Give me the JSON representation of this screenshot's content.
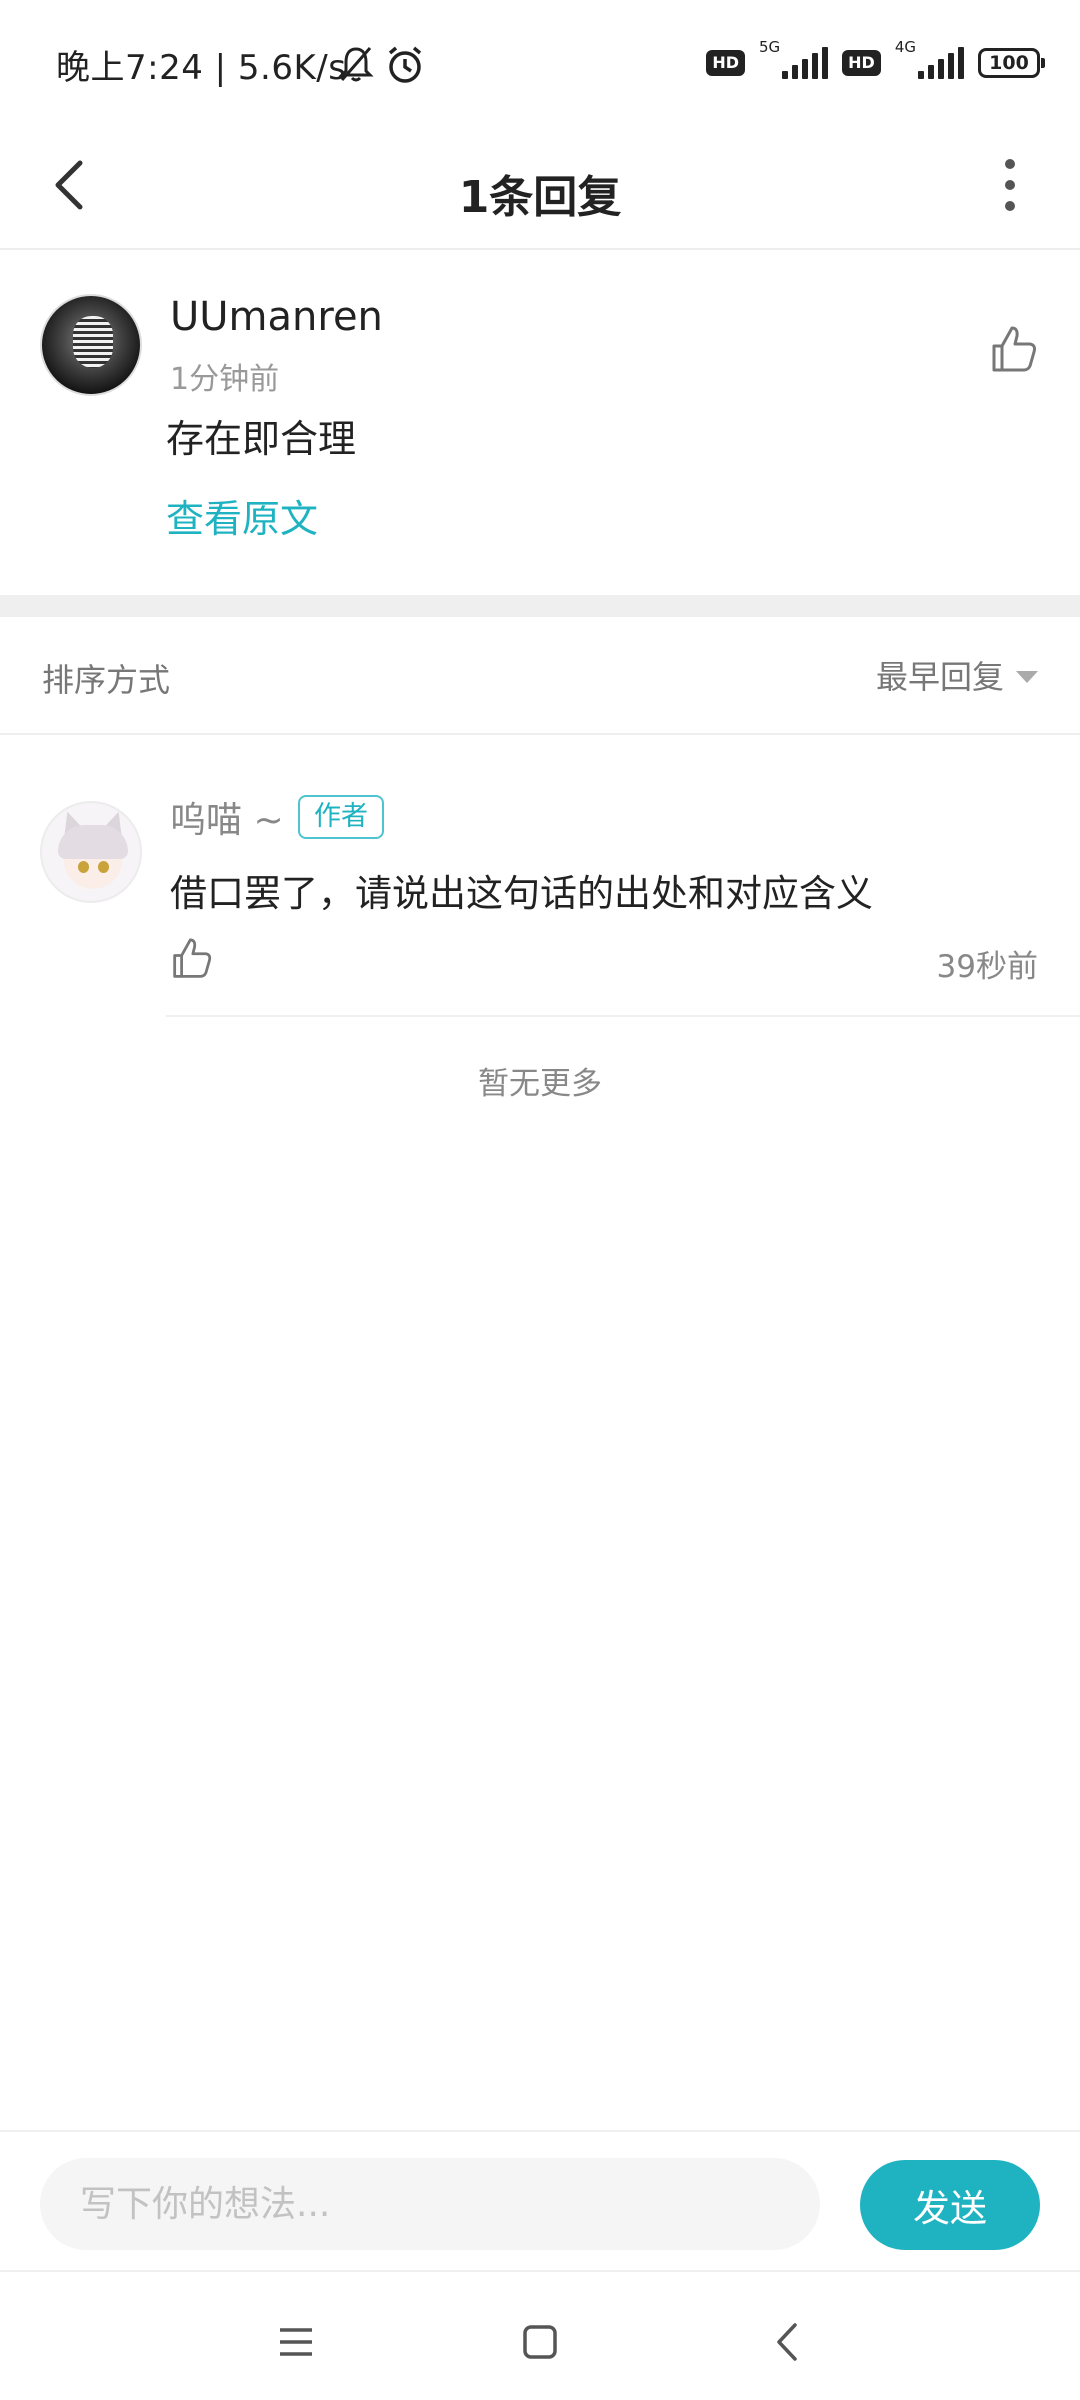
{
  "status_bar": {
    "time_speed": "晚上7:24 | 5.6K/s",
    "hd_badge_1": "HD",
    "net_1": "5G",
    "hd_badge_2": "HD",
    "net_2": "4G",
    "battery": "100",
    "icons": [
      "bell-off-icon",
      "alarm-icon",
      "signal-icon",
      "battery-icon"
    ]
  },
  "header": {
    "title": "1条回复",
    "back_icon": "back-arrow-icon",
    "more_icon": "more-vertical-icon"
  },
  "original_comment": {
    "username": "UUmanren",
    "time": "1分钟前",
    "text": "存在即合理",
    "view_original_label": "查看原文"
  },
  "sort": {
    "label": "排序方式",
    "selected": "最早回复"
  },
  "replies": [
    {
      "username": "呜喵 ~",
      "badge": "作者",
      "text": "借口罢了，请说出这句话的出处和对应含义",
      "time": "39秒前"
    }
  ],
  "no_more_text": "暂无更多",
  "composer": {
    "placeholder": "写下你的想法...",
    "send_label": "发送"
  },
  "colors": {
    "accent": "#1fb3c2",
    "text_primary": "#222222",
    "text_secondary": "#888888",
    "divider": "#eeeeee"
  }
}
